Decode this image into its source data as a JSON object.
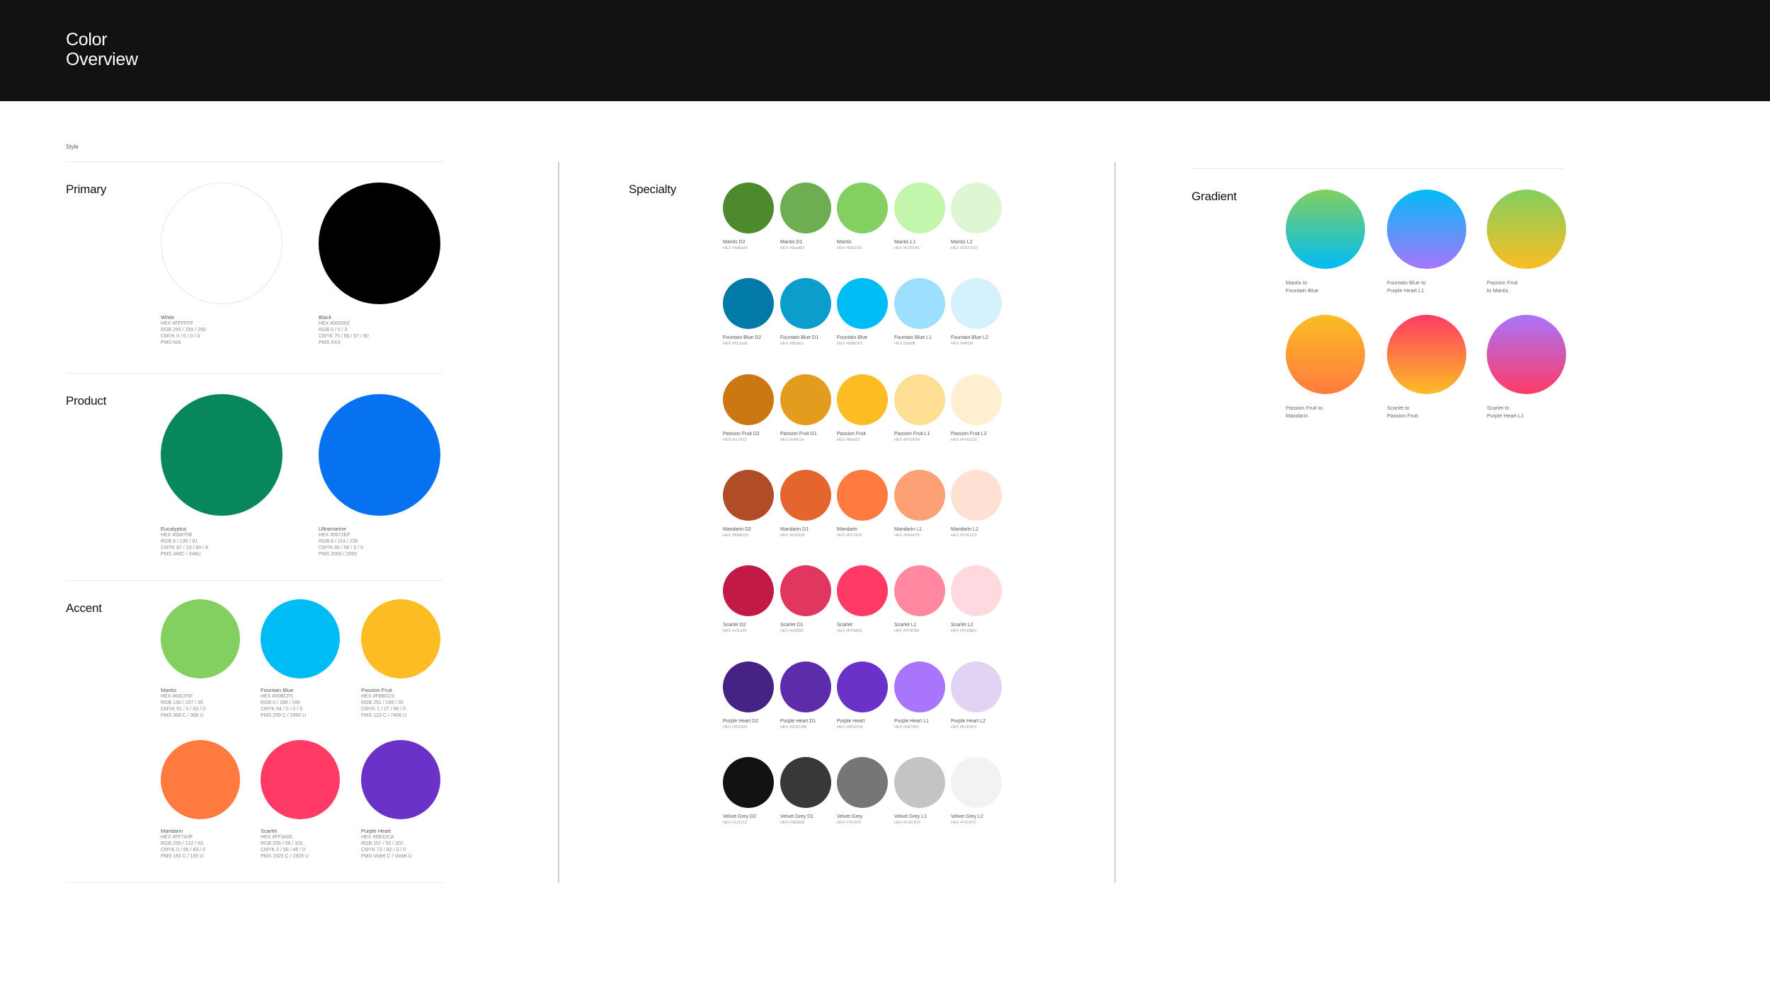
{
  "header": {
    "title_line1": "Color",
    "title_line2": "Overview"
  },
  "style_label": "Style",
  "primary": {
    "title": "Primary",
    "items": [
      {
        "name": "White",
        "lines": [
          "HEX #FFFFFF",
          "RGB 255 / 255 / 255",
          "CMYK 0 / 0 / 0 / 0",
          "PMS N/A"
        ],
        "color": "#FFFFFF"
      },
      {
        "name": "Black",
        "lines": [
          "HEX #000000",
          "RGB 0 / 0 / 0",
          "CMYK 75 / 68 / 67 / 90",
          "PMS XXX"
        ],
        "color": "#000000"
      }
    ]
  },
  "product": {
    "title": "Product",
    "items": [
      {
        "name": "Eucalyptus",
        "lines": [
          "HEX #08875B",
          "RGB 8 / 135 / 91",
          "CMYK 87 / 23 / 80 / 8",
          "PMS 348C / 348U"
        ],
        "color": "#08875B"
      },
      {
        "name": "Ultramarine",
        "lines": [
          "HEX #0672EF",
          "RGB 6 / 114 / 239",
          "CMYK 80 / 56 / 0 / 0",
          "PMS 2000 / 2000"
        ],
        "color": "#0672EF"
      }
    ]
  },
  "accent": {
    "title": "Accent",
    "items": [
      {
        "name": "Mantis",
        "lines": [
          "HEX #83CF5F",
          "RGB 130 / 207 / 95",
          "CMYK 51 / 0 / 83 / 0",
          "PMS 368 C / 368 U"
        ],
        "color": "#83CF5F"
      },
      {
        "name": "Fountain Blue",
        "lines": [
          "HEX #00BCF5",
          "RGB 0 / 188 / 245",
          "CMYK 84 / 0 / 0 / 0",
          "PMS 299 C / 2990 U"
        ],
        "color": "#00BCF5"
      },
      {
        "name": "Passion Fruit",
        "lines": [
          "HEX #FBBD23",
          "RGB 251 / 189 / 35",
          "CMYK 1 / 27 / 96 / 0",
          "PMS 123 C / 7406 U"
        ],
        "color": "#FBBD23"
      },
      {
        "name": "Mandarin",
        "lines": [
          "HEX #FF7A3F",
          "RGB 255 / 122 / 63",
          "CMYK 0 / 65 / 83 / 0",
          "PMS 165 C / 165 U"
        ],
        "color": "#FF7A3F"
      },
      {
        "name": "Scarlet",
        "lines": [
          "HEX #FF3A65",
          "RGB 255 / 58 / 101",
          "CMYK 0 / 90 / 45 / 0",
          "PMS 1925 C / 1925 U"
        ],
        "color": "#FF3A65"
      },
      {
        "name": "Purple Heart",
        "lines": [
          "HEX #6B32CA",
          "RGB 107 / 50 / 202",
          "CMYK 72 / 82 / 0 / 0",
          "PMS Violet C / Violet U"
        ],
        "color": "#6B32CA"
      }
    ]
  },
  "specialty": {
    "title": "Specialty",
    "rows": [
      [
        {
          "name": "Mantis D2",
          "hex": "HEX #4d8a2d",
          "color": "#4d8a2d"
        },
        {
          "name": "Mantis D1",
          "hex": "HEX #6ead52",
          "color": "#6ead52"
        },
        {
          "name": "Mantis",
          "hex": "HEX #83CF5F",
          "color": "#83CF5F"
        },
        {
          "name": "Mantis L1",
          "hex": "HEX #C2F6AC",
          "color": "#C2F6AC"
        },
        {
          "name": "Mantis L2",
          "hex": "HEX #DEF7D3",
          "color": "#DEF7D3"
        }
      ],
      [
        {
          "name": "Fountain Blue D2",
          "hex": "HEX #017aa8",
          "color": "#017aa8"
        },
        {
          "name": "Fountain Blue D1",
          "hex": "HEX #0b9dcc",
          "color": "#0b9dcc"
        },
        {
          "name": "Fountain Blue",
          "hex": "HEX #00BCF5",
          "color": "#00BCF5"
        },
        {
          "name": "Fountain Blue L1",
          "hex": "HEX #9ddfff",
          "color": "#9ddfff"
        },
        {
          "name": "Fountain Blue L2",
          "hex": "HEX #d4f1fd",
          "color": "#d4f1fd"
        }
      ],
      [
        {
          "name": "Passion Fruit D2",
          "hex": "HEX #cc7812",
          "color": "#cc7812"
        },
        {
          "name": "Passion Fruit D1",
          "hex": "HEX #e49c1e",
          "color": "#e49c1e"
        },
        {
          "name": "Passion Fruit",
          "hex": "HEX #fbbd23",
          "color": "#fbbd23"
        },
        {
          "name": "Passion Fruit L1",
          "hex": "HEX #FFDF94",
          "color": "#FFDF94"
        },
        {
          "name": "Passion Fruit L2",
          "hex": "HEX #FFEED0",
          "color": "#FFEED0"
        }
      ],
      [
        {
          "name": "Mandarin D2",
          "hex": "HEX #B04D26",
          "color": "#B04D26"
        },
        {
          "name": "Mandarin D1",
          "hex": "HEX #E5652F",
          "color": "#E5652F"
        },
        {
          "name": "Mandarin",
          "hex": "HEX #FF7A3F",
          "color": "#FF7A3F"
        },
        {
          "name": "Mandarin L1",
          "hex": "HEX #FEA075",
          "color": "#FEA075"
        },
        {
          "name": "Mandarin L2",
          "hex": "HEX #FFE1D3",
          "color": "#FFE1D3"
        }
      ],
      [
        {
          "name": "Scarlet D2",
          "hex": "HEX #c11a45",
          "color": "#c11a45"
        },
        {
          "name": "Scarlet D1",
          "hex": "HEX #e0365f",
          "color": "#e0365f"
        },
        {
          "name": "Scarlet",
          "hex": "HEX #FF3A65",
          "color": "#FF3A65"
        },
        {
          "name": "Scarlet L1",
          "hex": "HEX #FF87A0",
          "color": "#FF87A0"
        },
        {
          "name": "Scarlet L2",
          "hex": "HEX #FFD8E0",
          "color": "#FFD8E0"
        }
      ],
      [
        {
          "name": "Purple Heart D2",
          "hex": "HEX #462284",
          "color": "#462284"
        },
        {
          "name": "Purple Heart D1",
          "hex": "HEX #5D2CAB",
          "color": "#5D2CAB"
        },
        {
          "name": "Purple Heart",
          "hex": "HEX #6B32CA",
          "color": "#6B32CA"
        },
        {
          "name": "Purple Heart L1",
          "hex": "HEX #A875FC",
          "color": "#A875FC"
        },
        {
          "name": "Purple Heart L2",
          "hex": "HEX #E1D3F4",
          "color": "#E1D3F4"
        }
      ],
      [
        {
          "name": "Velvet Grey D2",
          "hex": "HEX #121212",
          "color": "#121212"
        },
        {
          "name": "Velvet Grey D1",
          "hex": "HEX #383838",
          "color": "#383838"
        },
        {
          "name": "Velvet Grey",
          "hex": "HEX #767676",
          "color": "#767676"
        },
        {
          "name": "Velvet Grey L1",
          "hex": "HEX #C4C4C4",
          "color": "#C4C4C4"
        },
        {
          "name": "Velvet Grey L2",
          "hex": "HEX #F2F2F2",
          "color": "#F2F2F2"
        }
      ]
    ]
  },
  "gradient": {
    "title": "Gradient",
    "items": [
      {
        "line1": "Mantis to",
        "line2": "Fountain Blue",
        "from": "#83CF5F",
        "to": "#00BCF5"
      },
      {
        "line1": "Fountain Blue to",
        "line2": "Purple Heart L1",
        "from": "#00BCF5",
        "to": "#A875FC"
      },
      {
        "line1": "Passion Fruit",
        "line2": "to Mantis",
        "from": "#83CF5F",
        "to": "#FBBD23"
      },
      {
        "line1": "Passion Fruit to",
        "line2": "Mandarin",
        "from": "#FBBD23",
        "to": "#FF7A3F"
      },
      {
        "line1": "Scarlet to",
        "line2": "Passion Fruit",
        "from": "#FF3A65",
        "to": "#FBBD23"
      },
      {
        "line1": "Scarlet to",
        "line2": "Purple Heart L1",
        "from": "#A875FC",
        "to": "#FF3A65"
      }
    ]
  }
}
